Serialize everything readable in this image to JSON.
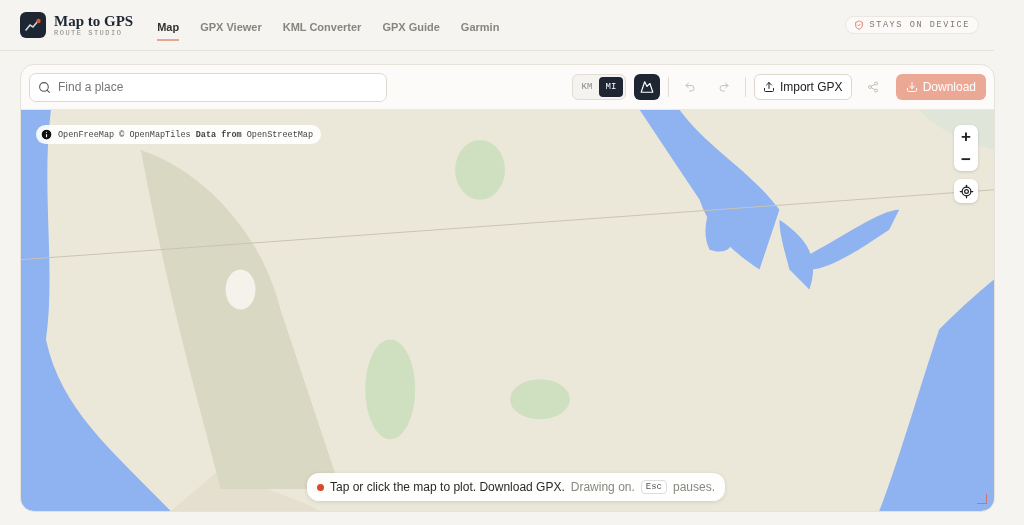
{
  "brand": {
    "title": "Map to GPS",
    "subtitle": "ROUTE STUDIO"
  },
  "nav": [
    {
      "label": "Map",
      "selected": true
    },
    {
      "label": "GPX Viewer",
      "selected": false
    },
    {
      "label": "KML Converter",
      "selected": false
    },
    {
      "label": "GPX Guide",
      "selected": false
    },
    {
      "label": "Garmin",
      "selected": false
    }
  ],
  "badge": "STAYS ON DEVICE",
  "toolbar": {
    "search": {
      "placeholder": "Find a place"
    },
    "units": [
      {
        "label": "KM",
        "selected": false
      },
      {
        "label": "MI",
        "selected": true
      }
    ],
    "terrain": {
      "on": true
    },
    "undo": {
      "disabled": true
    },
    "redo": {
      "disabled": true
    },
    "import": {
      "label": "Import GPX"
    },
    "download": {
      "label": "Download",
      "disabled": true
    }
  },
  "map": {
    "kind": "picture",
    "attribution": "OpenFreeMap © OpenMapTiles **Data from** OpenStreetMap",
    "zoom_in": "+",
    "zoom_out": "−"
  },
  "hint": {
    "active": true,
    "message": "Tap or click the map to plot. Download GPX.",
    "state": "Drawing on.",
    "key": "Esc",
    "after": "pauses."
  }
}
